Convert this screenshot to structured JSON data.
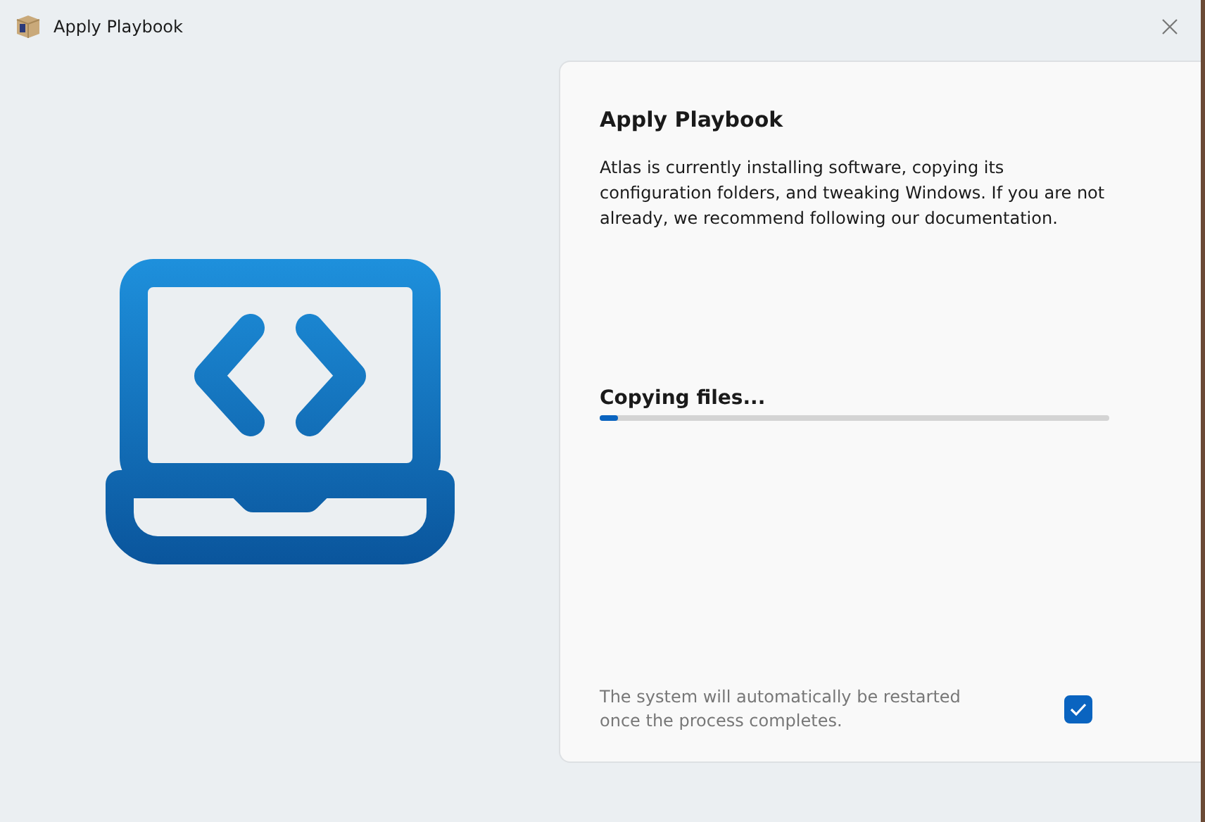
{
  "window": {
    "title": "Apply Playbook"
  },
  "panel": {
    "heading": "Apply Playbook",
    "description": "Atlas is currently installing software, copying its configuration folders, and tweaking Windows. If you are not already, we recommend following our documentation.",
    "status": "Copying files...",
    "progress": {
      "level": 0.035
    },
    "restart_note": "The system will automatically be restarted once the process completes.",
    "restart_checkbox": {
      "checked": true
    }
  }
}
